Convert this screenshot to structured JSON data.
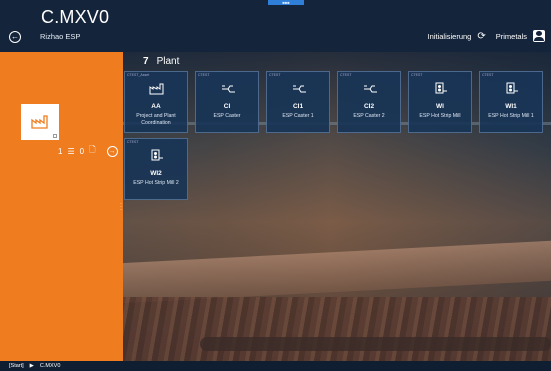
{
  "app": {
    "title": "C.MXV0",
    "subtitle": "Rizhao ESP",
    "top_indicator": "■■■"
  },
  "user": {
    "mode_label": "Initialisierung",
    "org_label": "Primetals"
  },
  "left": {
    "count_primary": "1",
    "count_secondary": "0"
  },
  "section": {
    "count": "7",
    "title": "Plant"
  },
  "tiles": [
    {
      "tag": "CTEST_Asset",
      "code": "AA",
      "name": "Project and Plant Coordination",
      "icon": "plant-icon"
    },
    {
      "tag": "CTEST",
      "code": "CI",
      "name": "ESP Caster",
      "icon": "caster-icon"
    },
    {
      "tag": "CTEST",
      "code": "CI1",
      "name": "ESP Caster 1",
      "icon": "caster-icon"
    },
    {
      "tag": "CTEST",
      "code": "CI2",
      "name": "ESP Caster 2",
      "icon": "caster-icon"
    },
    {
      "tag": "CTEST",
      "code": "WI",
      "name": "ESP Hot Strip Mill",
      "icon": "mill-icon"
    },
    {
      "tag": "CTEST",
      "code": "WI1",
      "name": "ESP Hot Strip Mill 1",
      "icon": "mill-icon"
    },
    {
      "tag": "CTEST",
      "code": "WI2",
      "name": "ESP Hot Strip Mill 2",
      "icon": "mill-icon"
    }
  ],
  "status": {
    "start": "[Start]",
    "separator": "▶",
    "current": "C.MXV0"
  }
}
